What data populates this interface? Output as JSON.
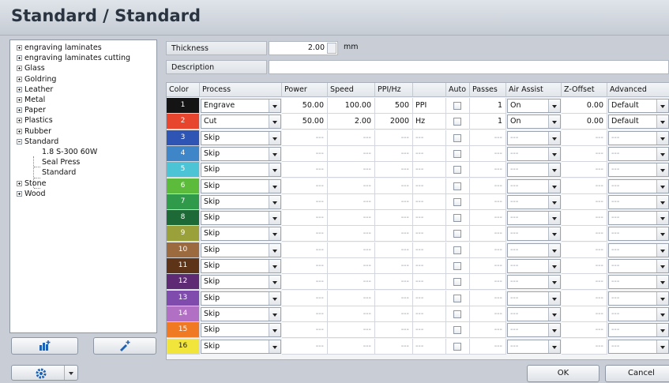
{
  "title": "Standard / Standard",
  "tree": {
    "items": [
      {
        "label": "engraving laminates",
        "expander": "plus"
      },
      {
        "label": "engraving laminates cutting",
        "expander": "plus"
      },
      {
        "label": "Glass",
        "expander": "plus"
      },
      {
        "label": "Goldring",
        "expander": "plus"
      },
      {
        "label": "Leather",
        "expander": "plus"
      },
      {
        "label": "Metal",
        "expander": "plus"
      },
      {
        "label": "Paper",
        "expander": "plus"
      },
      {
        "label": "Plastics",
        "expander": "plus"
      },
      {
        "label": "Rubber",
        "expander": "plus"
      },
      {
        "label": "Standard",
        "expander": "minus"
      },
      {
        "label": "1.8 S-300 60W",
        "child": true
      },
      {
        "label": "Seal Press",
        "child": true
      },
      {
        "label": "Standard",
        "child": true
      },
      {
        "label": "Stone",
        "expander": "plus"
      },
      {
        "label": "Wood",
        "expander": "plus"
      }
    ]
  },
  "props": {
    "thickness_label": "Thickness",
    "thickness_value": "2.00",
    "thickness_unit": "mm",
    "description_label": "Description",
    "description_value": ""
  },
  "table": {
    "headers": {
      "color": "Color",
      "process": "Process",
      "power": "Power",
      "speed": "Speed",
      "ppi": "PPI/Hz",
      "auto": "Auto",
      "passes": "Passes",
      "air": "Air Assist",
      "zoffset": "Z-Offset",
      "advanced": "Advanced"
    },
    "rows": [
      {
        "n": "1",
        "color": "#141414",
        "process": "Engrave",
        "power": "50.00",
        "speed": "100.00",
        "ppi": "500",
        "unit": "PPI",
        "passes": "1",
        "air": "On",
        "z": "0.00",
        "adv": "Default"
      },
      {
        "n": "2",
        "color": "#e8452e",
        "process": "Cut",
        "power": "50.00",
        "speed": "2.00",
        "ppi": "2000",
        "unit": "Hz",
        "passes": "1",
        "air": "On",
        "z": "0.00",
        "adv": "Default"
      },
      {
        "n": "3",
        "color": "#2f55b4",
        "process": "Skip",
        "power": "---",
        "speed": "---",
        "ppi": "---",
        "unit": "---",
        "passes": "---",
        "air": "---",
        "z": "---",
        "adv": "---"
      },
      {
        "n": "4",
        "color": "#3f86c9",
        "process": "Skip",
        "power": "---",
        "speed": "---",
        "ppi": "---",
        "unit": "---",
        "passes": "---",
        "air": "---",
        "z": "---",
        "adv": "---"
      },
      {
        "n": "5",
        "color": "#4cc4d6",
        "process": "Skip",
        "power": "---",
        "speed": "---",
        "ppi": "---",
        "unit": "---",
        "passes": "---",
        "air": "---",
        "z": "---",
        "adv": "---"
      },
      {
        "n": "6",
        "color": "#5dbb3c",
        "process": "Skip",
        "power": "---",
        "speed": "---",
        "ppi": "---",
        "unit": "---",
        "passes": "---",
        "air": "---",
        "z": "---",
        "adv": "---"
      },
      {
        "n": "7",
        "color": "#2e9a4a",
        "process": "Skip",
        "power": "---",
        "speed": "---",
        "ppi": "---",
        "unit": "---",
        "passes": "---",
        "air": "---",
        "z": "---",
        "adv": "---"
      },
      {
        "n": "8",
        "color": "#1d6a36",
        "process": "Skip",
        "power": "---",
        "speed": "---",
        "ppi": "---",
        "unit": "---",
        "passes": "---",
        "air": "---",
        "z": "---",
        "adv": "---"
      },
      {
        "n": "9",
        "color": "#9aa13a",
        "process": "Skip",
        "power": "---",
        "speed": "---",
        "ppi": "---",
        "unit": "---",
        "passes": "---",
        "air": "---",
        "z": "---",
        "adv": "---"
      },
      {
        "n": "10",
        "color": "#9b6a3e",
        "process": "Skip",
        "power": "---",
        "speed": "---",
        "ppi": "---",
        "unit": "---",
        "passes": "---",
        "air": "---",
        "z": "---",
        "adv": "---"
      },
      {
        "n": "11",
        "color": "#5e3418",
        "process": "Skip",
        "power": "---",
        "speed": "---",
        "ppi": "---",
        "unit": "---",
        "passes": "---",
        "air": "---",
        "z": "---",
        "adv": "---"
      },
      {
        "n": "12",
        "color": "#5e2a73",
        "process": "Skip",
        "power": "---",
        "speed": "---",
        "ppi": "---",
        "unit": "---",
        "passes": "---",
        "air": "---",
        "z": "---",
        "adv": "---"
      },
      {
        "n": "13",
        "color": "#7f4cae",
        "process": "Skip",
        "power": "---",
        "speed": "---",
        "ppi": "---",
        "unit": "---",
        "passes": "---",
        "air": "---",
        "z": "---",
        "adv": "---"
      },
      {
        "n": "14",
        "color": "#b170c4",
        "process": "Skip",
        "power": "---",
        "speed": "---",
        "ppi": "---",
        "unit": "---",
        "passes": "---",
        "air": "---",
        "z": "---",
        "adv": "---"
      },
      {
        "n": "15",
        "color": "#f07a24",
        "process": "Skip",
        "power": "---",
        "speed": "---",
        "ppi": "---",
        "unit": "---",
        "passes": "---",
        "air": "---",
        "z": "---",
        "adv": "---"
      },
      {
        "n": "16",
        "color": "#f1e43a",
        "process": "Skip",
        "power": "---",
        "speed": "---",
        "ppi": "---",
        "unit": "---",
        "passes": "---",
        "air": "---",
        "z": "---",
        "adv": "---"
      }
    ]
  },
  "buttons": {
    "ok": "OK",
    "cancel": "Cancel"
  },
  "icons": {
    "accent": "#1c63b8",
    "add_material": "add-material-icon",
    "edit_material": "edit-material-icon",
    "settings": "gear-icon"
  }
}
